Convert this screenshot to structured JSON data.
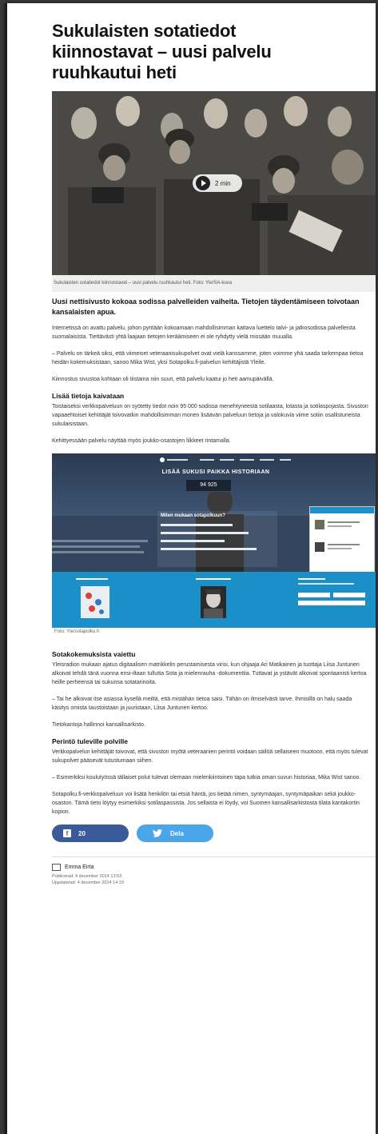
{
  "article": {
    "title": "Sukulaisten sotatiedot kiinnostavat – uusi palvelu ruuhkautui heti",
    "hero": {
      "video_duration": "2 min",
      "caption": "Sukulaisten sotatiedot kiinnostavat – uusi palvelu ruuhkautui heti. Foto: Yle/SA-kuva"
    },
    "lead": "Uusi nettisivusto kokoaa sodissa palvelleiden vaiheita. Tietojen täydentämiseen toivotaan kansalaisten apua.",
    "paragraphs_1": [
      "Internetissä on avattu palvelu, johon pyritään kokoamaan mahdollisimman kattava luettelo talvi- ja jatkosodissa palvelleista suomalaisista. Tiettävästi yhtä laajaan tietojen keräämiseen ei ole ryhdytty vielä missään muualla.",
      "– Palvelu on tärkeä siksi, että viimeiset veteraanisukupolvet ovat vielä kanssamme, joten voimme yhä saada tarkempaa tietoa heidän kokemuksistaan, sanoo Mika Wist, yksi Sotapolku.fi-palvelun kehittäjistä Yleile.",
      "Kiinnostus sivustoa kohtaan oli tiistaina niin suuri, että palvelu kaatui jo heti aamupäivällä."
    ],
    "sub_1": "Lisää tietoja kaivataan",
    "paragraphs_2": [
      "Toistaiseksi verkkopalveluun on syötetty tiedot noin 95 000 sodissa menehtyneestä sotilaasta, lotasta ja sotilaspojasta. Sivuston vapaaehtoiset kehittäjät toivovatkin mahdollisimman monen lisäävän palveluun tietoja ja valokuvia viime sotiin osallistuneista sukulaisistaan.",
      "Kehittyessään palvelu näyttää myös joukko-osastojen liikkeet rintamalla."
    ],
    "mid_image": {
      "banner": "LISÄÄ SUKUSI PAIKKA HISTORIAAN",
      "counter": "94 925",
      "quiz_title": "Miten mukaan sotapolkuun?",
      "caption": "Foto: Yle/sotapolku.fi"
    },
    "sub_2": "Sotakokemuksista vaiettu",
    "paragraphs_3": [
      "Yleisradion mukaan ajatus digitaalisen matrikkelin perustamisesta virisi, kun ohjaaja Ari Matikainen ja tuottaja Liisa Juntunen alkoivat tehdä tänä vuonna ensi-iltaan tullutta Sota ja mielenrauha -dokumenttia. Tuttavat ja ystävät alkoivat spontaanisti kertoa heille perheensä tai sukunsa sotatarinoita.",
      "– Tai he alkoivat itse asiassa kysellä meiltä, että mistähän tietoa saisi. Tähän on ilmiselvästi tarve. Ihmisillä on halu saada käsitys omista taustoistaan ja juuristaan, Liisa Juntunen kertoo.",
      "Tietokantoja hallinnoi kansallisarkisto."
    ],
    "sub_3": "Perintö tuleville polville",
    "paragraphs_4": [
      "Verkkopalvelun kehittäjät toivovat, että sivuston myötä veteraanien perintö voidaan säilöä sellaiseen muotoon, että myös tulevat sukupolvet pääsevät tutustumaan siihen.",
      "– Esimerkiksi koulutyössä tällaiset polut tulevat olemaan mielenkiintoinen tapa tutkia oman suvun historiaa, Mika Wist sanoo.",
      "Sotapolku.fi-verkkopalveluun voi lisätä henkilön tai etsiä häntä, jos tietää nimen, syntymäajan, syntymäpaikan sekä joukko-osaston. Tämä tieto löytyy esimerkiksi sotilaspassista. Jos sellaista ei löydy, voi Suomen kansallisarkistosta tilata kantakortin kopion."
    ],
    "share": {
      "facebook_count": "20",
      "twitter_label": "Dela"
    },
    "author": "Emma Eirta",
    "published": "Publicerad: 4 december 2014 13:53",
    "updated": "Uppdaterad: 4 december 2014 14:19"
  },
  "colors": {
    "facebook": "#3b5a99",
    "twitter": "#4aa6e8",
    "site_teal": "#1b8fc7"
  }
}
